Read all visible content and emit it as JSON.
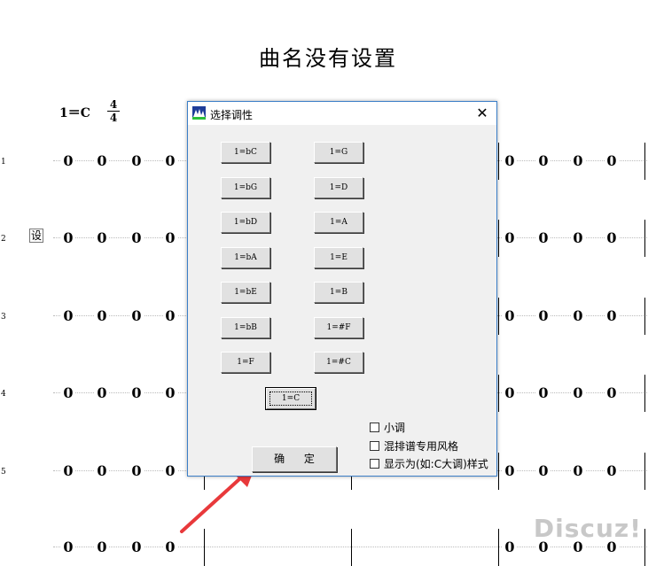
{
  "score": {
    "title": "曲名没有设置",
    "key_signature": "1＝C",
    "time_signature_top": "4",
    "time_signature_bottom": "4",
    "side_label": "设",
    "row_numbers": [
      "1",
      "2",
      "3",
      "4",
      "5"
    ],
    "note": "0"
  },
  "watermark": "Discuz!",
  "dialog": {
    "title": "选择调性",
    "close_label": "✕",
    "key_buttons_left": [
      "1=bC",
      "1=bG",
      "1=bD",
      "1=bA",
      "1=bE",
      "1=bB",
      "1=F"
    ],
    "key_buttons_right": [
      "1=G",
      "1=D",
      "1=A",
      "1=E",
      "1=B",
      "1=#F",
      "1=#C"
    ],
    "default_key": "1=C",
    "checkboxes": [
      "小调",
      "混排谱专用风格",
      "显示为(如:C大调)样式"
    ],
    "ok_label": "确 定"
  },
  "colors": {
    "dialog_border": "#3c7fc8",
    "arrow": "#e8393b",
    "watermark": "#c8c8c8"
  }
}
